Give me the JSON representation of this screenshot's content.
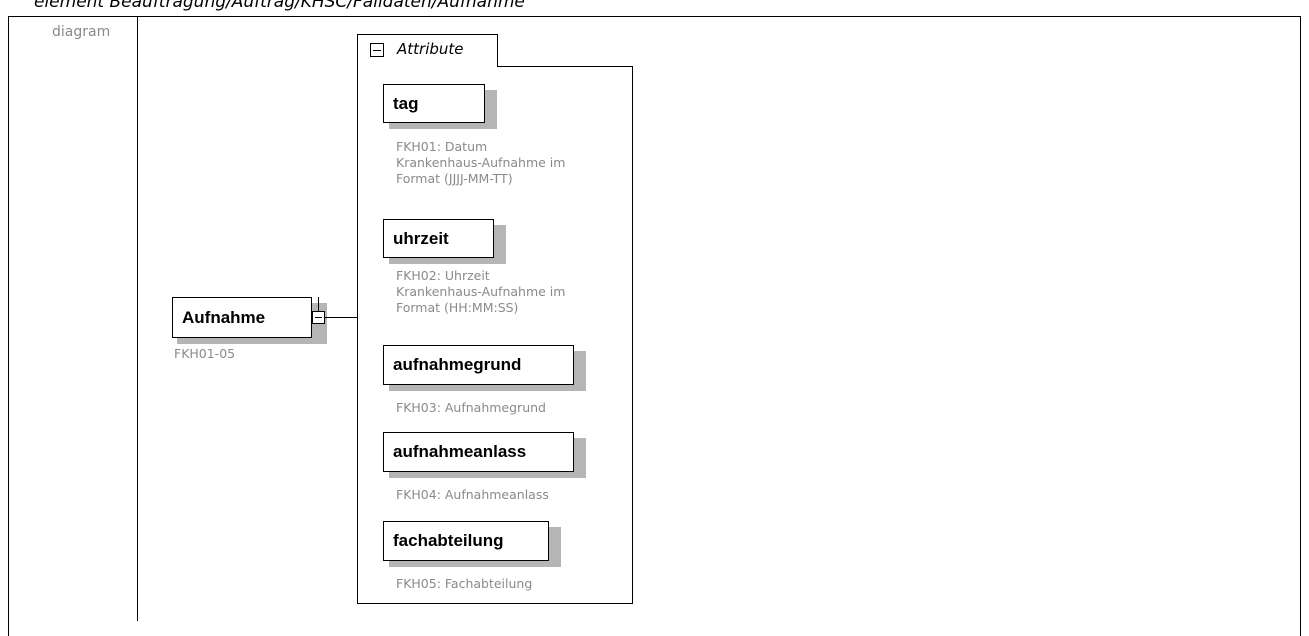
{
  "header": {
    "title": "element Beauftragung/Auftrag/KHSC/Falldaten/Aufnahme"
  },
  "row": {
    "label": "diagram"
  },
  "root_element": {
    "name": "Aufnahme",
    "description": "FKH01-05"
  },
  "attribute_group": {
    "label": "Attribute",
    "attributes": [
      {
        "name": "tag",
        "description": [
          "FKH01: Datum",
          "Krankenhaus-Aufnahme im",
          "Format (JJJJ-MM-TT)"
        ]
      },
      {
        "name": "uhrzeit",
        "description": [
          "FKH02: Uhrzeit",
          "Krankenhaus-Aufnahme im",
          "Format (HH:MM:SS)"
        ]
      },
      {
        "name": "aufnahmegrund",
        "description": [
          "FKH03: Aufnahmegrund"
        ]
      },
      {
        "name": "aufnahmeanlass",
        "description": [
          "FKH04: Aufnahmeanlass"
        ]
      },
      {
        "name": "fachabteilung",
        "description": [
          "FKH05: Fachabteilung"
        ]
      }
    ]
  }
}
